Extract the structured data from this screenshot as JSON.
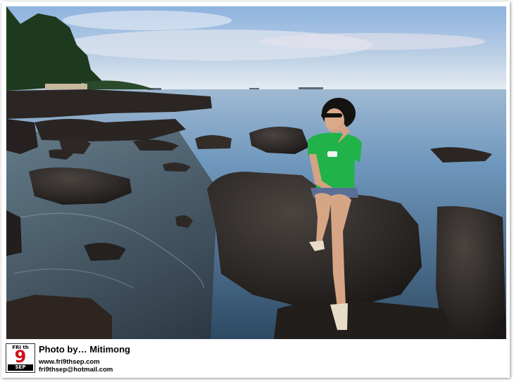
{
  "photo": {
    "description_icon": "beach-photo",
    "colors": {
      "sky_top": "#8fb3dc",
      "sky_bottom": "#eef2f6",
      "sea": "#5f8fb8",
      "rock": "#2a2624",
      "shirt": "#22b34a"
    }
  },
  "footer": {
    "logo": {
      "top": "FRI th",
      "number": "9",
      "bottom": "SEP"
    },
    "credit": "Photo  by… Mitimong",
    "website": "www.fri9thsep.com",
    "email": "fri9thsep@hotmail.com"
  }
}
